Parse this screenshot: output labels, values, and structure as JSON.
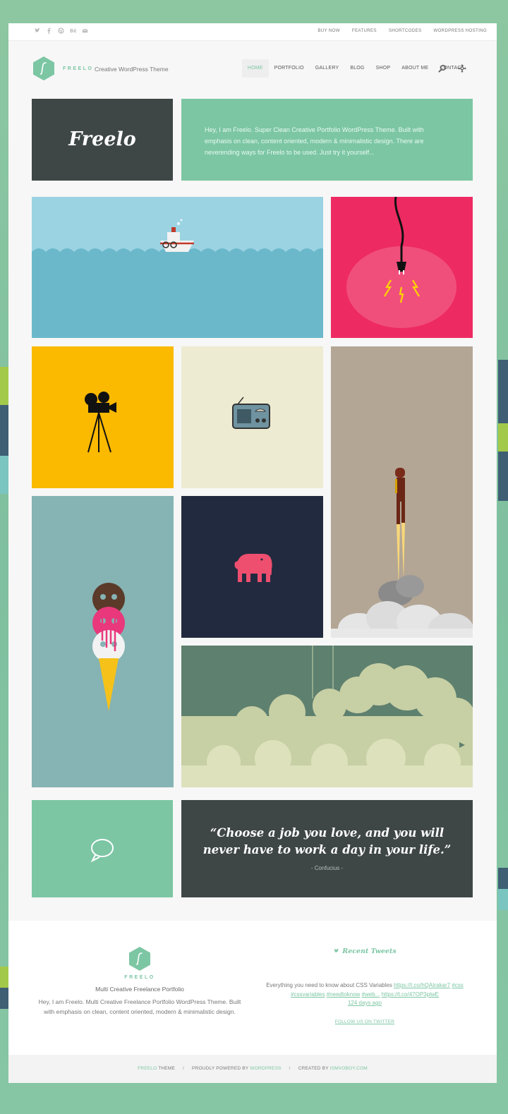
{
  "topbar": {
    "social_icons": [
      "twitter-icon",
      "facebook-icon",
      "dribbble-icon",
      "behance-icon",
      "email-icon"
    ],
    "links": [
      "BUY NOW",
      "FEATURES",
      "SHORTCODES",
      "WORDPRESS HOSTING"
    ]
  },
  "header": {
    "brand": "FREELO",
    "tagline": "Creative WordPress Theme",
    "nav": [
      "HOME",
      "PORTFOLIO",
      "GALLERY",
      "BLOG",
      "SHOP",
      "ABOUT ME",
      "CONTACT"
    ],
    "active_nav": "HOME"
  },
  "intro": {
    "title": "Freelo",
    "text": "Hey, I am Freelo. Super Clean Creative Portfolio WordPress Theme. Built with emphasis on clean, content oriented, modern & minimalistic design. There are neverending ways for Freelo to be used. Just try it yourself..."
  },
  "quote": {
    "text": "“Choose a job you love, and you will never have to work a day in your life.”",
    "author": "- Confucius -"
  },
  "footer": {
    "brand": "FREELO",
    "subtitle": "Multi Creative Freelance Portfolio",
    "description": "Hey, I am Freelo. Multi Creative Freelance Portfolio WordPress Theme. Built with emphasis on clean, content oriented, modern & minimalistic design.",
    "tweets_title": "Recent Tweets",
    "tweet_text": "Everything you need to know about CSS Variables",
    "tweet_link1": "https://t.co/hQAtrakar7",
    "tweet_tag1": "#css",
    "tweet_tag2": "#cssvariables",
    "tweet_tag3": "#needtoknow",
    "tweet_tag4": "#web...",
    "tweet_link2": "https://t.co/47OP3plwE",
    "tweet_time": "124 days ago",
    "follow": "FOLLOW US ON TWITTER"
  },
  "credits": {
    "theme_name": "FREELO",
    "theme_word": "THEME",
    "powered_prefix": "PROUDLY POWERED BY",
    "powered_link": "WORDPRESS",
    "created_prefix": "CREATED BY",
    "created_link": "ISMVOBOY.COM",
    "separator": "/"
  },
  "colors": {
    "accent": "#7cc6a4",
    "dark": "#3f4646",
    "pink": "#ee2a62",
    "yellow": "#fbb900",
    "navy": "#222a3f"
  }
}
